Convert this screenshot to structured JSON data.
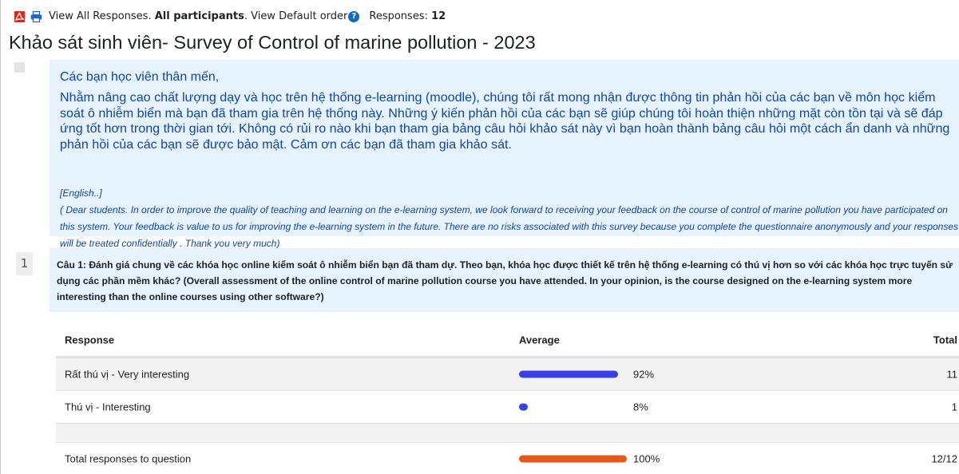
{
  "toolbar": {
    "view_all": "View All Responses.",
    "participants": "All participants",
    "view_default": "View Default order",
    "responses_label": "Responses:",
    "responses_count": "12"
  },
  "survey": {
    "title": "Khảo sát sinh viên- Survey of Control of marine pollution - 2023"
  },
  "intro": {
    "greeting": "Các bạn học viên thân mến,",
    "body_vi": "Nhằm nâng cao chất lượng dạy và học trên hệ thống e-learning (moodle), chúng tôi rất mong nhận được thông tin phản hồi của các bạn về môn học kiểm soát ô nhiễm biển mà bạn đã tham gia trên hệ thống này. Những ý kiến phản hồi của các bạn sẽ giúp chúng tôi hoàn thiện những mặt còn tồn tại và sẽ đáp ứng tốt hơn trong thời gian tới. Không có rủi ro nào khi bạn tham gia bảng câu hỏi khảo sát này vì bạn hoàn thành bảng câu hỏi một cách ẩn danh và những phản hồi của các bạn sẽ được bảo mật. Cảm ơn các bạn đã tham gia khảo sát.",
    "english_tag": "[English..]",
    "body_en": "( Dear students. In order to improve the quality of teaching and learning on the e-learning system, we look forward to receiving your feedback on the course of control of marine pollution you have participated on this system. Your feedback is value to us for improving the e-learning system in the future. There are no risks associated with this survey because you complete the questionnaire anonymously and your responses will be treated confidentially . Thank you very much)"
  },
  "question": {
    "number": "1",
    "text": "Câu 1: Đánh giá chung về các khóa học online kiểm soát ô nhiễm biển bạn đã tham dự. Theo bạn, khóa học được thiết kế trên hệ thống e-learning có thú vị hơn so với các khóa học trực tuyến sử dụng các phần mềm khác? (Overall assessment of the online control of marine pollution course you have attended. In your opinion, is the course designed on the e-learning system more interesting than the online courses using other software?)"
  },
  "results": {
    "headers": {
      "response": "Response",
      "average": "Average",
      "total": "Total"
    },
    "rows": [
      {
        "label": "Rất thú vị - Very interesting",
        "percent_text": "92%",
        "fraction": 0.92,
        "total": "11",
        "color": "#3b3fe8"
      },
      {
        "label": "Thú vị - Interesting",
        "percent_text": "8%",
        "fraction": 0.08,
        "total": "1",
        "color": "#3b3fe8"
      }
    ],
    "summary": {
      "label": "Total responses to question",
      "percent_text": "100%",
      "fraction": 1.0,
      "total": "12/12",
      "color": "#e8571a"
    }
  }
}
